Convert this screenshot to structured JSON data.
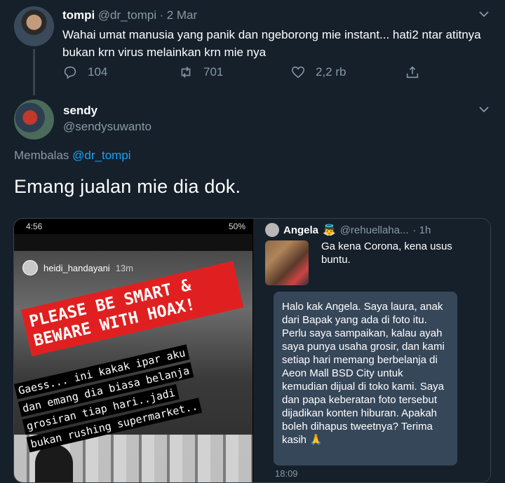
{
  "tweet1": {
    "name": "tompi",
    "handle": "@dr_tompi",
    "separator": "·",
    "date": "2 Mar",
    "text": "Wahai umat manusia yang panik dan ngeborong mie instant... hati2 ntar atitnya bukan krn virus melainkan krn mie nya",
    "replies": "104",
    "retweets": "701",
    "likes": "2,2 rb"
  },
  "tweet2": {
    "name": "sendy",
    "handle": "@sendysuwanto",
    "reply_prefix": "Membalas",
    "reply_to": "@dr_tompi",
    "text": "Emang jualan mie dia dok."
  },
  "media": {
    "left": {
      "status_time": "4:56",
      "status_right": "50%",
      "story_user": "heidi_handayani",
      "story_ago": "13m",
      "banner_lines": [
        "PLEASE BE SMART &",
        "BEWARE WITH HOAX!"
      ],
      "caption_lines": [
        "Gaess... ini kakak ipar aku",
        "dan emang dia biasa belanja",
        "grosiran tiap hari..jadi",
        "bukan rushing supermarket.."
      ]
    },
    "right": {
      "name": "Angela",
      "emoji": "👼",
      "handle": "@rehuellaha...",
      "time": "· 1h",
      "quoted_text": "Ga kena Corona, kena usus buntu.",
      "dm_text": "Halo kak Angela. Saya laura, anak dari Bapak yang ada di foto itu. Perlu saya sampaikan, kalau ayah saya punya usaha grosir, dan kami setiap hari memang berbelanja di Aeon Mall BSD City untuk kemudian dijual di toko kami. Saya dan papa keberatan foto tersebut dijadikan konten hiburan. Apakah boleh dihapus tweetnya? Terima kasih 🙏",
      "dm_time": "18:09"
    }
  },
  "colors": {
    "background": "#15202b",
    "muted": "#8899a6",
    "link": "#1da1f2",
    "border": "#38444d"
  }
}
